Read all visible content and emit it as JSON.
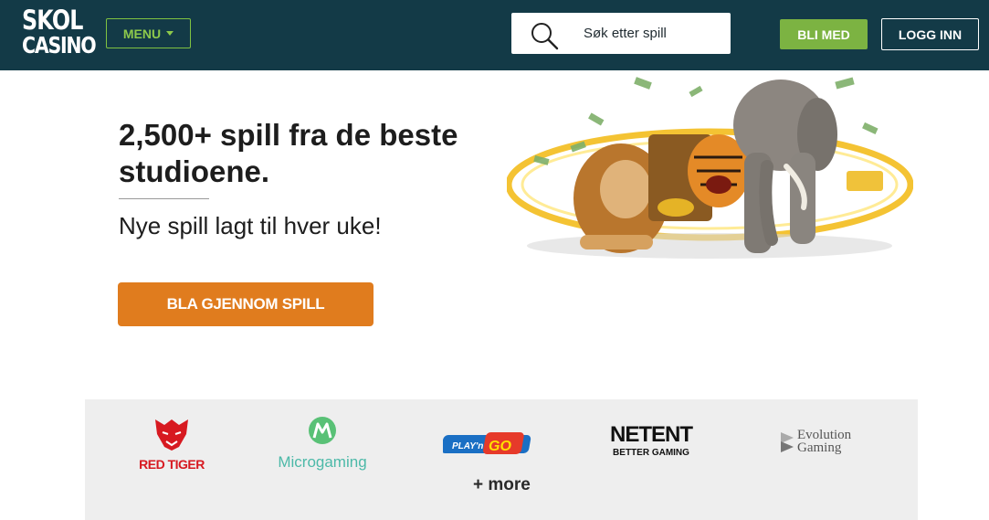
{
  "header": {
    "logo_line1": "SKOL",
    "logo_line2": "CASINO",
    "menu_label": "MENU",
    "search_placeholder": "Søk etter spill",
    "join_label": "BLI MED",
    "login_label": "LOGG INN"
  },
  "hero": {
    "title": "2,500+ spill fra de beste studioene.",
    "subtitle": "Nye spill lagt til hver uke!",
    "cta_label": "BLA GJENNOM SPILL"
  },
  "providers": {
    "items": [
      {
        "name": "RED TIGER",
        "icon": "red-tiger-logo"
      },
      {
        "name": "Microgaming",
        "icon": "microgaming-logo"
      },
      {
        "name": "PLAY'n GO",
        "icon": "playngo-logo"
      },
      {
        "name_line1": "NETENT",
        "name_line2": "BETTER GAMING",
        "icon": "netent-logo"
      },
      {
        "name_line1": "Evolution",
        "name_line2": "Gaming",
        "icon": "evolution-logo"
      }
    ],
    "more_label": "+ more"
  },
  "colors": {
    "header_bg": "#133a47",
    "accent_green": "#7cb342",
    "cta_orange": "#e07c1e",
    "providers_bg": "#eeeeee"
  }
}
